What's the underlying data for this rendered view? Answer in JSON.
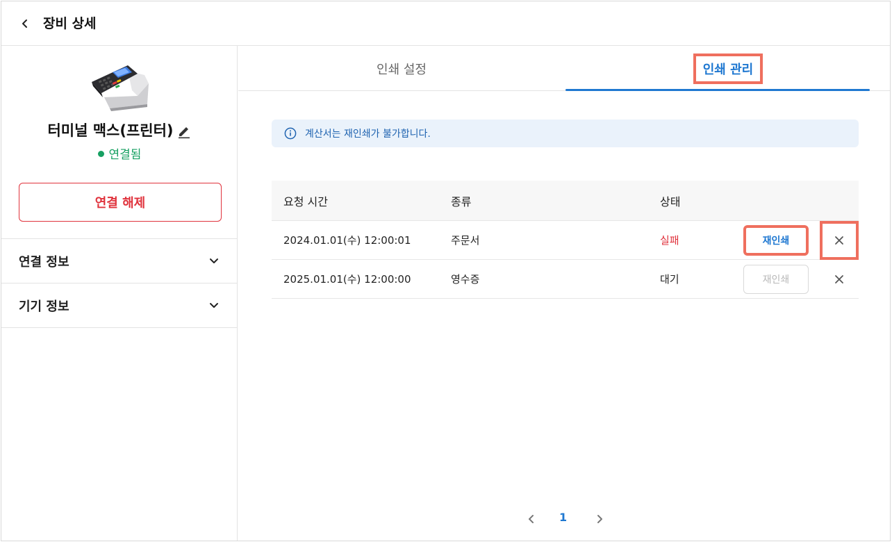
{
  "header": {
    "title": "장비 상세",
    "back_icon": "chevron-left-icon"
  },
  "device": {
    "name": "터미널 맥스(프린터)",
    "edit_icon": "pencil-icon",
    "status": "연결됨",
    "status_color": "#17a062",
    "disconnect_label": "연결 해제",
    "disconnect_color": "#e0323c"
  },
  "accordions": [
    {
      "label": "연결 정보",
      "icon": "chevron-down-icon"
    },
    {
      "label": "기기 정보",
      "icon": "chevron-down-icon"
    }
  ],
  "tabs": [
    {
      "label": "인쇄 설정",
      "active": false
    },
    {
      "label": "인쇄 관리",
      "active": true
    }
  ],
  "info": {
    "icon": "info-circle-icon",
    "text": "계산서는 재인쇄가 불가합니다."
  },
  "table": {
    "headers": [
      "요청 시간",
      "종류",
      "상태"
    ],
    "rows": [
      {
        "time": "2024.01.01(수) 12:00:01",
        "type": "주문서",
        "state": "실패",
        "reprint_label": "재인쇄",
        "reprint_enabled": true
      },
      {
        "time": "2025.01.01(수) 12:00:00",
        "type": "영수증",
        "state": "대기",
        "reprint_label": "재인쇄",
        "reprint_enabled": false
      }
    ]
  },
  "pagination": {
    "current_page": "1"
  },
  "colors": {
    "accent": "#1f78d1",
    "highlight": "#ef6f5e",
    "info_bg": "#eaf2fb"
  }
}
